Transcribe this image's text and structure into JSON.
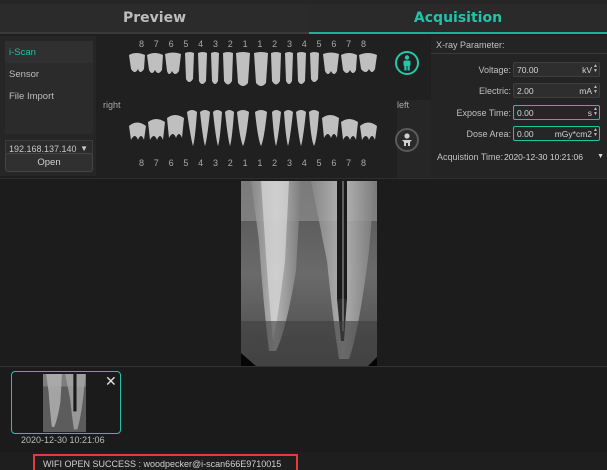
{
  "tabs": {
    "preview": "Preview",
    "acquisition": "Acquisition"
  },
  "left_panel": {
    "modes": [
      "i-Scan",
      "Sensor",
      "File Import"
    ],
    "active_mode": "i-Scan",
    "ip_address": "192.168.137.140",
    "open_label": "Open"
  },
  "teeth_chart": {
    "top_numbers": [
      "8",
      "7",
      "6",
      "5",
      "4",
      "3",
      "2",
      "1",
      "1",
      "2",
      "3",
      "4",
      "5",
      "6",
      "7",
      "8"
    ],
    "bottom_numbers": [
      "8",
      "7",
      "6",
      "5",
      "4",
      "3",
      "2",
      "1",
      "1",
      "2",
      "3",
      "4",
      "5",
      "6",
      "7",
      "8"
    ],
    "right_label": "right",
    "left_label": "left"
  },
  "xray_params": {
    "title": "X-ray Parameter:",
    "voltage": {
      "label": "Voltage:",
      "value": "70.00",
      "unit": "kV"
    },
    "electric": {
      "label": "Electric:",
      "value": "2.00",
      "unit": "mA"
    },
    "expose_time": {
      "label": "Expose Time:",
      "value": "0.00",
      "unit": "s"
    },
    "dose_area": {
      "label": "Dose Area:",
      "value": "0.00",
      "unit": "mGy*cm2"
    },
    "acquisition_time": {
      "label": "Acquistion Time:",
      "value": "2020-12-30 10:21:06"
    }
  },
  "thumbnail": {
    "date": "2020-12-30 10:21:06",
    "close": "✕"
  },
  "status": {
    "message": "WIFI OPEN SUCCESS : woodpecker@i-scan666E9710015"
  },
  "colors": {
    "accent": "#22c3a8",
    "status_border": "#e23b3b"
  }
}
